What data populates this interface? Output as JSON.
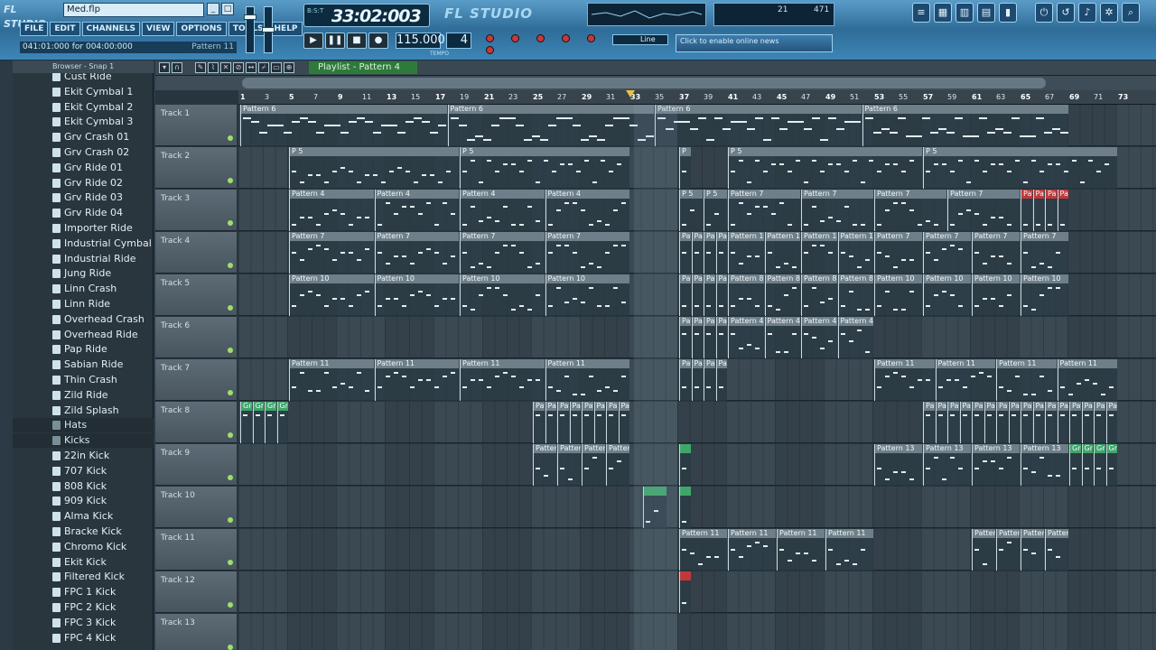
{
  "app": {
    "logo": "FL STUDIO",
    "title": "Med.flp",
    "brand": "FL STUDIO"
  },
  "menu": [
    "FILE",
    "EDIT",
    "CHANNELS",
    "VIEW",
    "OPTIONS",
    "TOOLS",
    "HELP"
  ],
  "hint": {
    "left": "041:01:000 for 004:00:000",
    "right": "Pattern 11"
  },
  "time": {
    "value": "33:02:003",
    "mode": "B:S:T"
  },
  "tempo": {
    "value": "115.000",
    "label": "TEMPO"
  },
  "pattern_number": "4",
  "line_mode": "Line",
  "news": "Click to enable online news",
  "cpu": {
    "a": "21",
    "b": "471"
  },
  "transport": {
    "play": "▶",
    "pause": "❚❚",
    "stop": "■",
    "record": "●"
  },
  "browser": {
    "title": "Browser - Snap 1",
    "items": [
      {
        "label": "Cust Ride",
        "folder": false
      },
      {
        "label": "Ekit Cymbal 1",
        "folder": false
      },
      {
        "label": "Ekit Cymbal 2",
        "folder": false
      },
      {
        "label": "Ekit Cymbal 3",
        "folder": false
      },
      {
        "label": "Grv Crash 01",
        "folder": false
      },
      {
        "label": "Grv Crash 02",
        "folder": false
      },
      {
        "label": "Grv Ride 01",
        "folder": false
      },
      {
        "label": "Grv Ride 02",
        "folder": false
      },
      {
        "label": "Grv Ride 03",
        "folder": false
      },
      {
        "label": "Grv Ride 04",
        "folder": false
      },
      {
        "label": "Importer Ride",
        "folder": false
      },
      {
        "label": "Industrial Cymbal",
        "folder": false
      },
      {
        "label": "Industrial Ride",
        "folder": false
      },
      {
        "label": "Jung Ride",
        "folder": false
      },
      {
        "label": "Linn Crash",
        "folder": false
      },
      {
        "label": "Linn Ride",
        "folder": false
      },
      {
        "label": "Overhead Crash",
        "folder": false
      },
      {
        "label": "Overhead Ride",
        "folder": false
      },
      {
        "label": "Pap Ride",
        "folder": false
      },
      {
        "label": "Sabian Ride",
        "folder": false
      },
      {
        "label": "Thin Crash",
        "folder": false
      },
      {
        "label": "Zild Ride",
        "folder": false
      },
      {
        "label": "Zild Splash",
        "folder": false
      },
      {
        "label": "Hats",
        "folder": true
      },
      {
        "label": "Kicks",
        "folder": true
      },
      {
        "label": "22in Kick",
        "folder": false
      },
      {
        "label": "707 Kick",
        "folder": false
      },
      {
        "label": "808 Kick",
        "folder": false
      },
      {
        "label": "909 Kick",
        "folder": false
      },
      {
        "label": "Alma Kick",
        "folder": false
      },
      {
        "label": "Bracke Kick",
        "folder": false
      },
      {
        "label": "Chromo Kick",
        "folder": false
      },
      {
        "label": "Ekit Kick",
        "folder": false
      },
      {
        "label": "Filtered Kick",
        "folder": false
      },
      {
        "label": "FPC 1 Kick",
        "folder": false
      },
      {
        "label": "FPC 2 Kick",
        "folder": false
      },
      {
        "label": "FPC 3 Kick",
        "folder": false
      },
      {
        "label": "FPC 4 Kick",
        "folder": false
      }
    ]
  },
  "playlist": {
    "title": "Playlist - Pattern 4",
    "ruler": [
      "1",
      "3",
      "5",
      "7",
      "9",
      "11",
      "13",
      "15",
      "17",
      "19",
      "21",
      "23",
      "25",
      "27",
      "29",
      "31",
      "33",
      "35",
      "37",
      "39",
      "41",
      "43",
      "45",
      "47",
      "49",
      "51",
      "53",
      "55",
      "57",
      "59",
      "61",
      "63",
      "65",
      "67",
      "69",
      "71",
      "73"
    ],
    "tracks": [
      {
        "name": "Track 1",
        "clips": [
          {
            "s": 1,
            "e": 69,
            "label": "Pattern 6",
            "rep": 4
          }
        ]
      },
      {
        "name": "Track 2",
        "clips": [
          {
            "s": 5,
            "e": 33,
            "label": "P 5",
            "rep": 2
          },
          {
            "s": 37,
            "e": 38,
            "label": "P",
            "rep": 1
          },
          {
            "s": 41,
            "e": 73,
            "label": "P 5",
            "rep": 2
          }
        ]
      },
      {
        "name": "Track 3",
        "clips": [
          {
            "s": 5,
            "e": 33,
            "label": "Pattern 4",
            "rep": 4
          },
          {
            "s": 37,
            "e": 41,
            "label": "P 5",
            "rep": 2
          },
          {
            "s": 41,
            "e": 65,
            "label": "Pattern 7",
            "rep": 4
          },
          {
            "s": 65,
            "e": 69,
            "label": "Pattern 4",
            "rep": 4,
            "color": "red"
          }
        ]
      },
      {
        "name": "Track 4",
        "clips": [
          {
            "s": 5,
            "e": 33,
            "label": "Pattern 7",
            "rep": 4
          },
          {
            "s": 37,
            "e": 41,
            "label": "Pattern 7",
            "rep": 4
          },
          {
            "s": 41,
            "e": 53,
            "label": "Pattern 10",
            "rep": 4
          },
          {
            "s": 53,
            "e": 69,
            "label": "Pattern 7",
            "rep": 4
          }
        ]
      },
      {
        "name": "Track 5",
        "clips": [
          {
            "s": 5,
            "e": 33,
            "label": "Pattern 10",
            "rep": 4
          },
          {
            "s": 37,
            "e": 41,
            "label": "Pattern 10",
            "rep": 4
          },
          {
            "s": 41,
            "e": 53,
            "label": "Pattern 8",
            "rep": 4
          },
          {
            "s": 53,
            "e": 69,
            "label": "Pattern 10",
            "rep": 4
          }
        ]
      },
      {
        "name": "Track 6",
        "clips": [
          {
            "s": 37,
            "e": 41,
            "label": "Pattern 8",
            "rep": 4
          },
          {
            "s": 41,
            "e": 53,
            "label": "Pattern 4",
            "rep": 4
          }
        ]
      },
      {
        "name": "Track 7",
        "clips": [
          {
            "s": 5,
            "e": 33,
            "label": "Pattern 11",
            "rep": 4
          },
          {
            "s": 37,
            "e": 41,
            "label": "Pattern 4",
            "rep": 4
          },
          {
            "s": 53,
            "e": 73,
            "label": "Pattern 11",
            "rep": 4
          }
        ]
      },
      {
        "name": "Track 8",
        "clips": [
          {
            "s": 1,
            "e": 5,
            "label": "Gross B...lope",
            "rep": 4,
            "color": "green"
          },
          {
            "s": 25,
            "e": 33,
            "label": "Pattern 12",
            "rep": 8
          },
          {
            "s": 57,
            "e": 65,
            "label": "Pattern 12",
            "rep": 8
          },
          {
            "s": 65,
            "e": 69,
            "label": "Pattern 19",
            "rep": 4
          },
          {
            "s": 69,
            "e": 73,
            "label": "Patt...21",
            "rep": 4
          }
        ]
      },
      {
        "name": "Track 9",
        "clips": [
          {
            "s": 25,
            "e": 33,
            "label": "Pattern 13",
            "rep": 4
          },
          {
            "s": 37,
            "e": 38,
            "label": "",
            "rep": 1,
            "color": "green"
          },
          {
            "s": 53,
            "e": 69,
            "label": "Pattern 13",
            "rep": 4
          },
          {
            "s": 69,
            "e": 73,
            "label": "Gross B...lope",
            "rep": 4,
            "color": "green"
          }
        ]
      },
      {
        "name": "Track 10",
        "clips": [
          {
            "s": 34,
            "e": 36,
            "label": "",
            "rep": 1,
            "color": "green"
          },
          {
            "s": 37,
            "e": 38,
            "label": "",
            "rep": 1,
            "color": "green"
          }
        ]
      },
      {
        "name": "Track 11",
        "clips": [
          {
            "s": 37,
            "e": 53,
            "label": "Pattern 11",
            "rep": 4
          },
          {
            "s": 61,
            "e": 69,
            "label": "Pattern 20",
            "rep": 4
          }
        ]
      },
      {
        "name": "Track 12",
        "clips": [
          {
            "s": 37,
            "e": 38,
            "label": "",
            "rep": 1,
            "color": "red"
          }
        ]
      },
      {
        "name": "Track 13",
        "clips": []
      }
    ]
  },
  "colors": {
    "accent": "#3d86b8",
    "lane": "#3b4953",
    "clip_header": "#6e7f89",
    "red": "#c23838",
    "green": "#3fa66a"
  }
}
